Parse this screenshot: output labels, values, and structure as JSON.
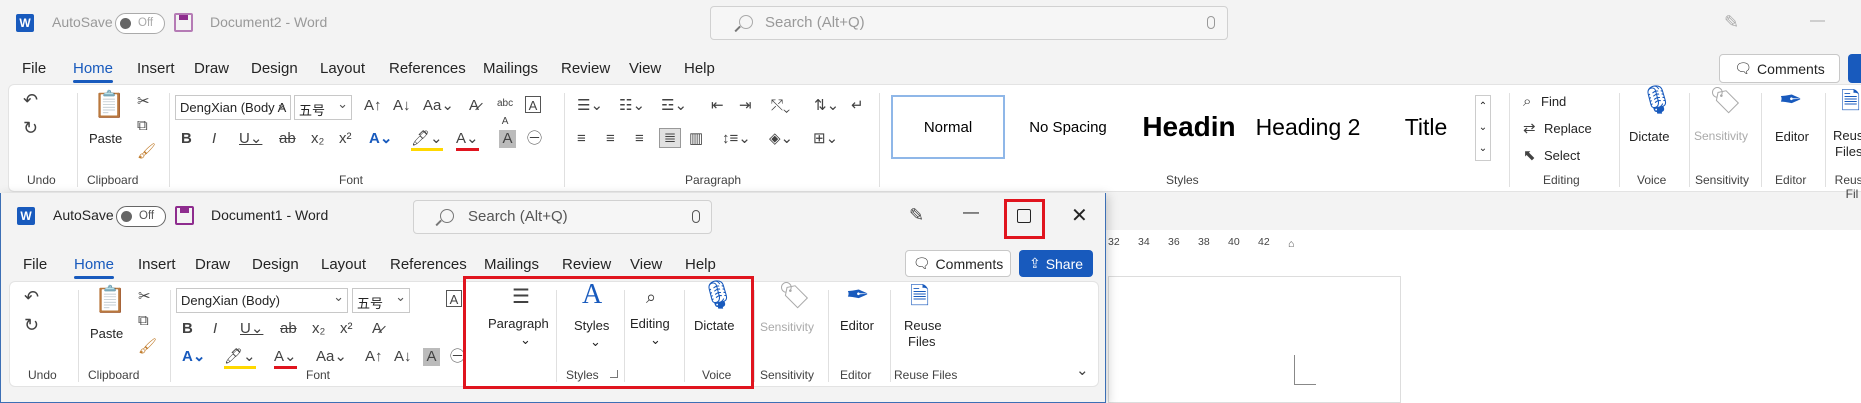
{
  "back": {
    "autosave_label": "AutoSave",
    "toggle": "Off",
    "doc_title": "Document2  -  Word",
    "search_placeholder": "Search (Alt+Q)",
    "tabs": [
      "File",
      "Home",
      "Insert",
      "Draw",
      "Design",
      "Layout",
      "References",
      "Mailings",
      "Review",
      "View",
      "Help"
    ],
    "comments_label": "Comments",
    "share_partial": "S",
    "font_name": "DengXian (Body A",
    "font_size": "五号",
    "groups": {
      "undo": "Undo",
      "clipboard": "Clipboard",
      "font": "Font",
      "paragraph": "Paragraph",
      "styles": "Styles",
      "editing": "Editing",
      "voice": "Voice",
      "sensitivity": "Sensitivity",
      "editor": "Editor",
      "reuse": "Reuse Fil"
    },
    "paste": "Paste",
    "styles": [
      "Normal",
      "No Spacing",
      "Headin",
      "Heading 2",
      "Title"
    ],
    "find": "Find",
    "replace": "Replace",
    "select": "Select",
    "dictate": "Dictate",
    "sensitivity": "Sensitivity",
    "editor": "Editor",
    "reuse": "Reuse",
    "reuse2": "Files",
    "ruler": [
      "32",
      "34",
      "36",
      "38",
      "40",
      "42"
    ]
  },
  "front": {
    "autosave_label": "AutoSave",
    "toggle": "Off",
    "doc_title": "Document1  -  Word",
    "search_placeholder": "Search (Alt+Q)",
    "tabs": [
      "File",
      "Home",
      "Insert",
      "Draw",
      "Design",
      "Layout",
      "References",
      "Mailings",
      "Review",
      "View",
      "Help"
    ],
    "comments_label": "Comments",
    "share_label": "Share",
    "font_name": "DengXian (Body)",
    "font_size": "五号",
    "paste": "Paste",
    "groups": {
      "undo": "Undo",
      "clipboard": "Clipboard",
      "font": "Font",
      "styles": "Styles",
      "voice": "Voice",
      "sensitivity": "Sensitivity",
      "editor": "Editor",
      "reuse": "Reuse Files"
    },
    "paragraph": "Paragraph",
    "styles_btn": "Styles",
    "editing": "Editing",
    "dictate": "Dictate",
    "sensitivity": "Sensitivity",
    "editor": "Editor",
    "reuse": "Reuse",
    "reuse2": "Files"
  },
  "colors": {
    "accent": "#185abd",
    "highlight": "#e0141e"
  }
}
